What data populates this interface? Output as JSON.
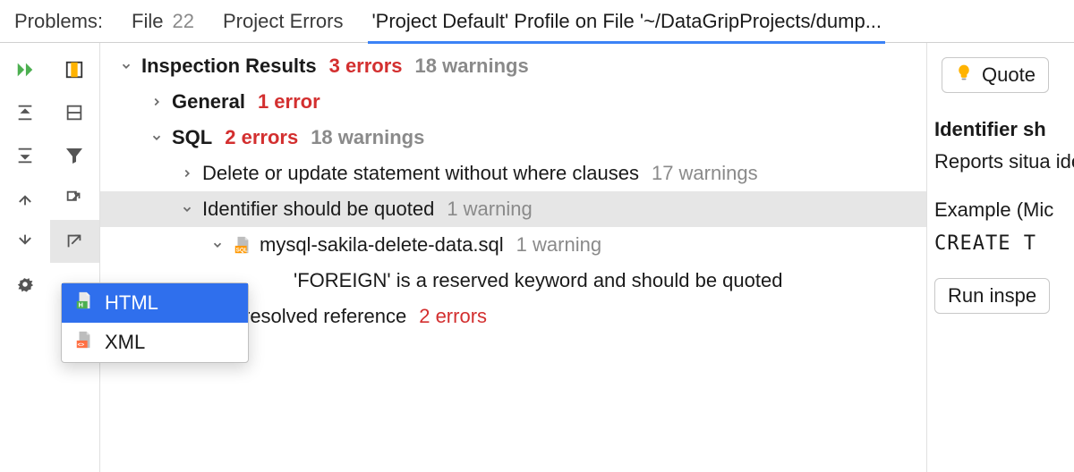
{
  "header": {
    "problems_label": "Problems:",
    "file_tab": "File",
    "file_count": "22",
    "projerr_tab": "Project Errors",
    "profile_tab": "'Project Default' Profile on File '~/DataGripProjects/dump..."
  },
  "tree": {
    "root_label": "Inspection Results",
    "root_err": "3 errors",
    "root_warn": "18 warnings",
    "general_label": "General",
    "general_err": "1 error",
    "sql_label": "SQL",
    "sql_err": "2 errors",
    "sql_warn": "18 warnings",
    "delete_label": "Delete or update statement without where clauses",
    "delete_warn": "17 warnings",
    "ident_label": "Identifier should be quoted",
    "ident_warn": "1 warning",
    "file_label": "mysql-sakila-delete-data.sql",
    "file_warn": "1 warning",
    "foreign_label": "'FOREIGN' is a reserved keyword and should be quoted",
    "unresolved_label": "resolved reference",
    "unresolved_err": "2 errors"
  },
  "popup": {
    "html": "HTML",
    "xml": "XML"
  },
  "right": {
    "quote_btn": "Quote",
    "title": "Identifier sh",
    "body": "Reports situa identifier nam",
    "example": "Example (Mic",
    "code": "CREATE T",
    "run_btn": "Run inspe"
  }
}
